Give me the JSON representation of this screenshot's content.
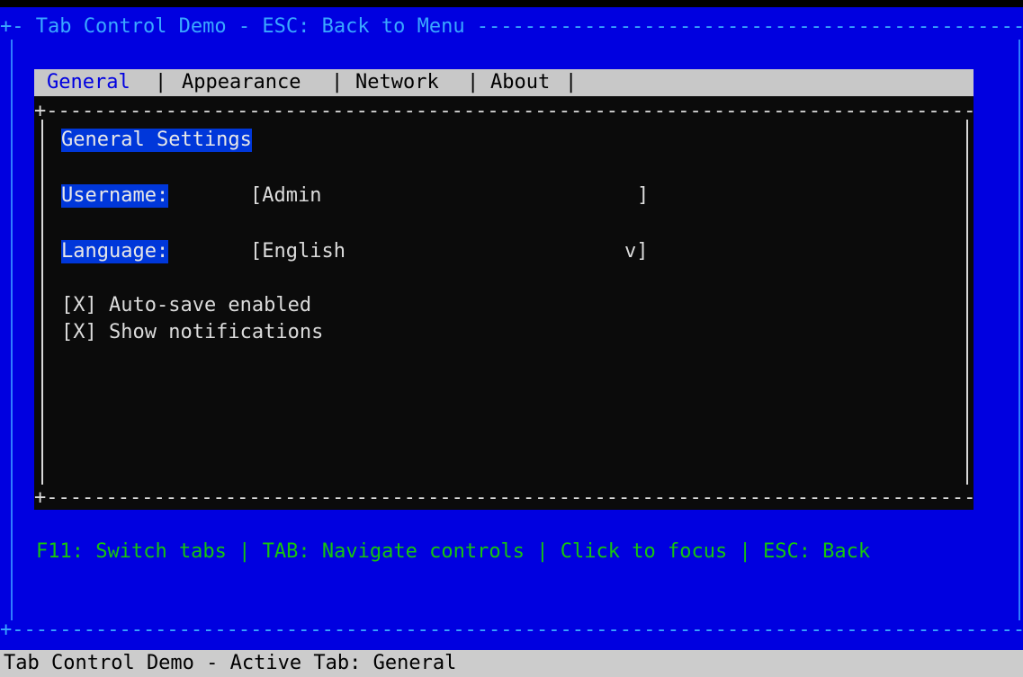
{
  "window": {
    "title": "+- Tab Control Demo - ESC: Back to Menu ------------------------------------------------+"
  },
  "tabs": [
    {
      "label": "General",
      "active": true
    },
    {
      "label": "Appearance",
      "active": false
    },
    {
      "label": "Network",
      "active": false
    },
    {
      "label": "About",
      "active": false
    }
  ],
  "tab_separator": "|",
  "panel": {
    "border_line": "+-------------------------------------------------------------------------------------------+",
    "heading": "General Settings",
    "username": {
      "label": "Username:",
      "value": "[Admin",
      "close": "]"
    },
    "language": {
      "label": "Language:",
      "value": "[English",
      "close": "v]"
    },
    "checkboxes": [
      {
        "text": "[X] Auto-save enabled",
        "checked": true
      },
      {
        "text": "[X] Show notifications",
        "checked": true
      }
    ]
  },
  "help": "F11: Switch tabs | TAB: Navigate controls | Click to focus | ESC: Back",
  "bottom_border": "+--------------------------------------------------------------------------------------------------------+",
  "status_bar": "Tab Control Demo - Active Tab: General",
  "colors": {
    "background": "#0000e0",
    "border": "#3aa8ff",
    "highlight": "#0037da",
    "help_text": "#16c60c",
    "panel": "#0b0b0b",
    "status_bar": "#cccccc"
  }
}
